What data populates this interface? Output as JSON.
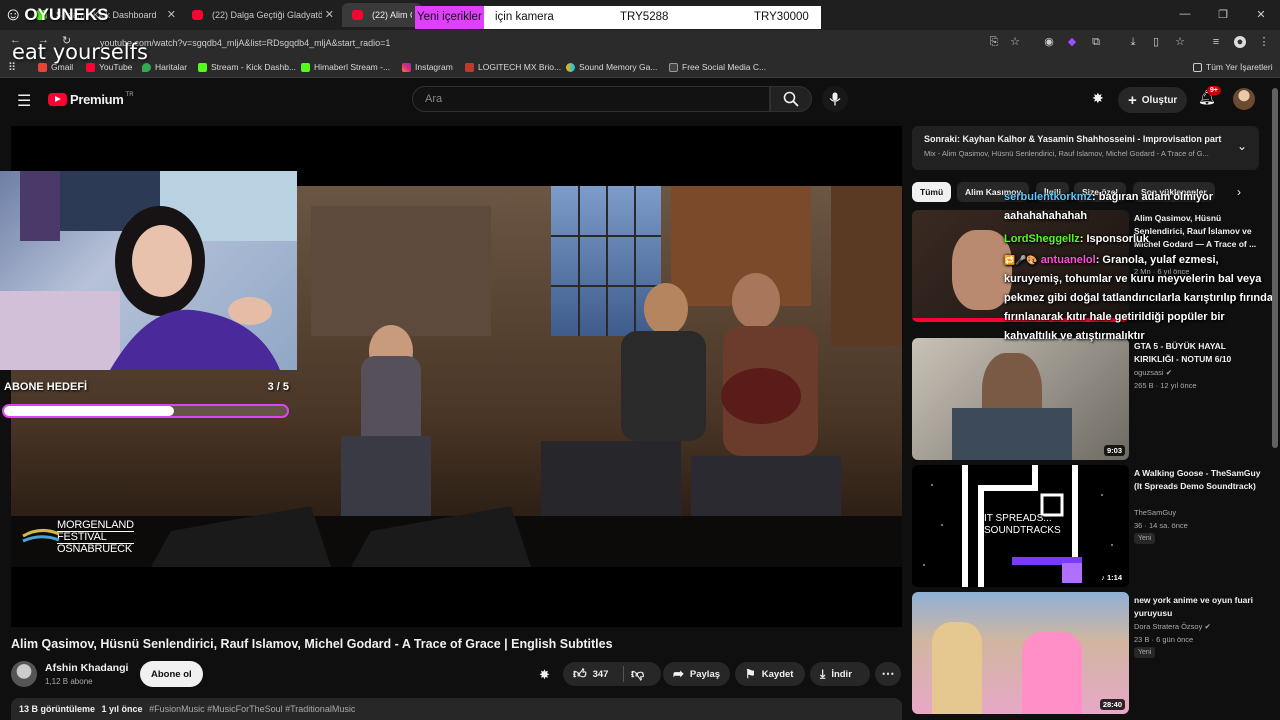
{
  "browser": {
    "tabs": [
      {
        "title": "Stream - Kick Dashboard",
        "color": "#53fc18"
      },
      {
        "title": "(22) Dalga Geçtiği Gladyatörden...",
        "color": "#ff0033"
      },
      {
        "title": "(22) Alim Qasimov...",
        "color": "#ff0033"
      }
    ],
    "url": "youtube.com/watch?v=sgqdb4_mljA&list=RDsgqdb4_mljA&start_radio=1",
    "bookmarks": [
      "Gmail",
      "YouTube",
      "Haritalar",
      "Stream - Kick Dashb...",
      "Himaberl Stream -...",
      "Instagram",
      "LOGITECH MX Brio...",
      "Sound Memory Ga...",
      "Free Social Media C..."
    ],
    "bookmarks_all": "Tüm Yer İşaretleri"
  },
  "overlay": {
    "logo": "OYUNEKS",
    "handwriting": "eat yourselfs",
    "alert_highlight": "Yeni içerikler",
    "alert_rest": " için kamera",
    "alert_price1": "TRY5288",
    "alert_price2": "TRY30000",
    "goal_label": "ABONE HEDEFİ",
    "goal_count": "3 / 5",
    "goal_progress": 0.6,
    "festival_1": "MORGENLAND",
    "festival_2": "FESTIVAL",
    "festival_3": "OSNABRUECK"
  },
  "yt": {
    "logo": "Premium",
    "logo_sup": "TR",
    "search_placeholder": "Ara",
    "create": "Oluştur",
    "notif_badge": "9+"
  },
  "video": {
    "title": "Alim Qasimov, Hüsnü Senlendirici, Rauf Islamov, Michel Godard - A Trace of Grace | English Subtitles",
    "channel": "Afshin Khadangi",
    "subs": "1,12 B abone",
    "subscribe": "Abone ol",
    "likes": "347",
    "share": "Paylaş",
    "save": "Kaydet",
    "download": "İndir",
    "views": "13 B görüntüleme",
    "age": "1 yıl önce",
    "tags": "#FusionMusic #MusicForTheSoul #TraditionalMusic"
  },
  "next": {
    "label": "Sonraki:",
    "title": "Kayhan Kalhor & Yasamin Shahhosseini - Improvisation part I",
    "sub": "Mix - Alim Qasimov, Hüsnü Senlendirici, Rauf Islamov, Michel Godard - A Trace of G..."
  },
  "chips": [
    "Tümü",
    "Alim Kasımov",
    "İlgili",
    "Size özel",
    "Son yüklenenler"
  ],
  "recs": [
    {
      "title": "Alim Qasimov, Hüsnü Şenlendirici, Rauf İslamov ve Michel Godard — A Trace of ...",
      "channel": "",
      "meta": "2 Mn · 6 yıl önce",
      "duration": "",
      "new": ""
    },
    {
      "title": "GTA 5 - BÜYÜK HAYAL KIRIKLIĞI - NOTUM 6/10",
      "channel": "oguzsasi",
      "meta": "265 B · 12 yıl önce",
      "duration": "9:03",
      "new": ""
    },
    {
      "title": "A Walking Goose - TheSamGuy (It Spreads Demo Soundtrack)",
      "channel": "TheSamGuy",
      "meta": "36 · 14 sa. önce",
      "duration": "1:14",
      "new": "Yeni",
      "thumb_text": "IT SPREADS... SOUNDTRACKS"
    },
    {
      "title": "new york anime ve oyun fuari yuruyusu",
      "channel": "Dora Stratera Özsoy",
      "meta": "23 B · 6 gün önce",
      "duration": "28:40",
      "new": "Yeni"
    }
  ],
  "chat": [
    {
      "user": "serbulentkorkmz",
      "msg": ": bağıran adam ölmiyor",
      "color": "#5cc8ff"
    },
    {
      "user": "",
      "msg": "aahahahahahah",
      "color": "#fff"
    },
    {
      "user": "LordSheggellz",
      "msg": ": Isponsorluk",
      "color": "#53fc18"
    },
    {
      "user": "antuanelol",
      "msg": ": Granola, yulaf ezmesi, kuruyemiş, tohumlar ve kuru meyvelerin bal veya pekmez gibi doğal tatlandırıcılarla karıştırılıp fırında fırınlanarak kıtır hale getirildiği popüler bir kahvaltılık ve atıştırmalıktır",
      "color": "#ff4fd8"
    }
  ]
}
